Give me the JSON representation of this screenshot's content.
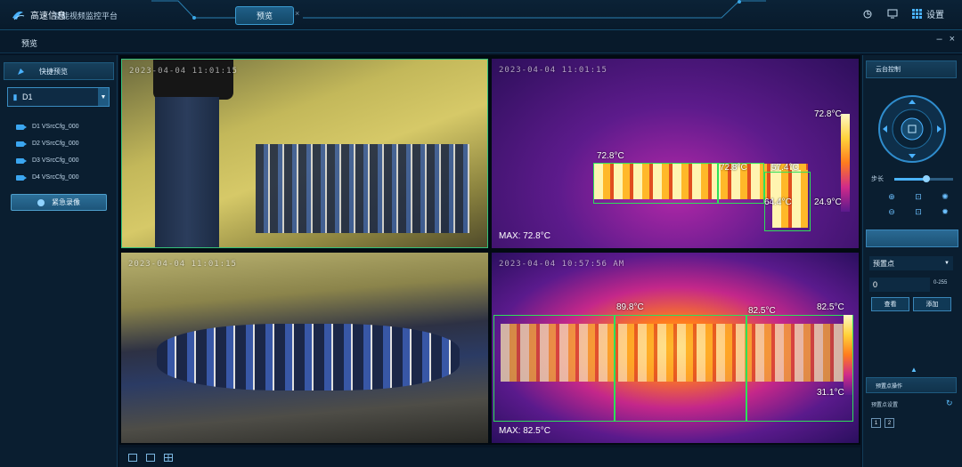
{
  "app": {
    "logo_text": "高速信息",
    "platform_title": "智能视频监控平台",
    "active_tab": "预览",
    "tab_close": "×",
    "settings_label": "设置"
  },
  "page": {
    "title": "预览",
    "min": "–",
    "close": "×"
  },
  "left": {
    "quick_preview": "快捷预览",
    "device": "D1",
    "cameras": [
      "D1 VSrcCfg_000",
      "D2 VSrcCfg_000",
      "D3 VSrcCfg_000",
      "D4 VSrcCfg_000"
    ],
    "emergency_record": "紧急录像"
  },
  "panes": {
    "p1": {
      "timestamp": "2023-04-04 11:01:15"
    },
    "p2": {
      "timestamp": "2023-04-04 11:01:15",
      "max": "MAX: 72.8°C",
      "labels": [
        "72.8°C",
        "72.8°C",
        "57.4°C",
        "64.4°C",
        "72.8°C",
        "24.9°C"
      ]
    },
    "p3": {
      "timestamp": "2023-04-04 11:01:15"
    },
    "p4": {
      "timestamp": "2023-04-04 10:57:56 AM",
      "max": "MAX: 82.5°C",
      "labels": [
        "89.8°C",
        "82.5°C",
        "82.5°C",
        "31.1°C"
      ]
    }
  },
  "right": {
    "ptz_title": "云台控制",
    "step_label": "步长",
    "preset_label": "预置点",
    "preset_value": "0",
    "preset_range": "0-255",
    "call_btn": "查看",
    "add_btn": "添加",
    "sub_title": "预置点操作",
    "sub_item": "预置点设置",
    "pages": [
      "1",
      "2"
    ],
    "step_level": 0.55
  },
  "colors": {
    "accent": "#3a9ad0",
    "box": "#2ee05a",
    "bg": "#061424"
  },
  "icons": [
    "logo-icon",
    "user-icon",
    "monitor-icon",
    "grid-icon",
    "camera-icon",
    "record-icon",
    "zoom-in-icon",
    "zoom-out-icon",
    "focus-icon",
    "iris-icon",
    "refresh-icon"
  ]
}
